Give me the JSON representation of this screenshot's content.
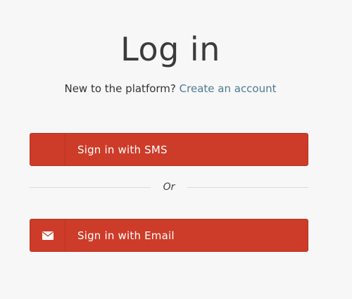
{
  "header": {
    "title": "Log in",
    "prompt": "New to the platform?",
    "create_account_link": "Create an account"
  },
  "buttons": {
    "sms": {
      "label": "Sign in with SMS",
      "icon": "none"
    },
    "email": {
      "label": "Sign in with Email",
      "icon": "envelope-icon"
    }
  },
  "divider": {
    "label": "Or"
  },
  "colors": {
    "accent": "#cd3c29",
    "link": "#4f7a93",
    "background": "#f7f7f7"
  }
}
